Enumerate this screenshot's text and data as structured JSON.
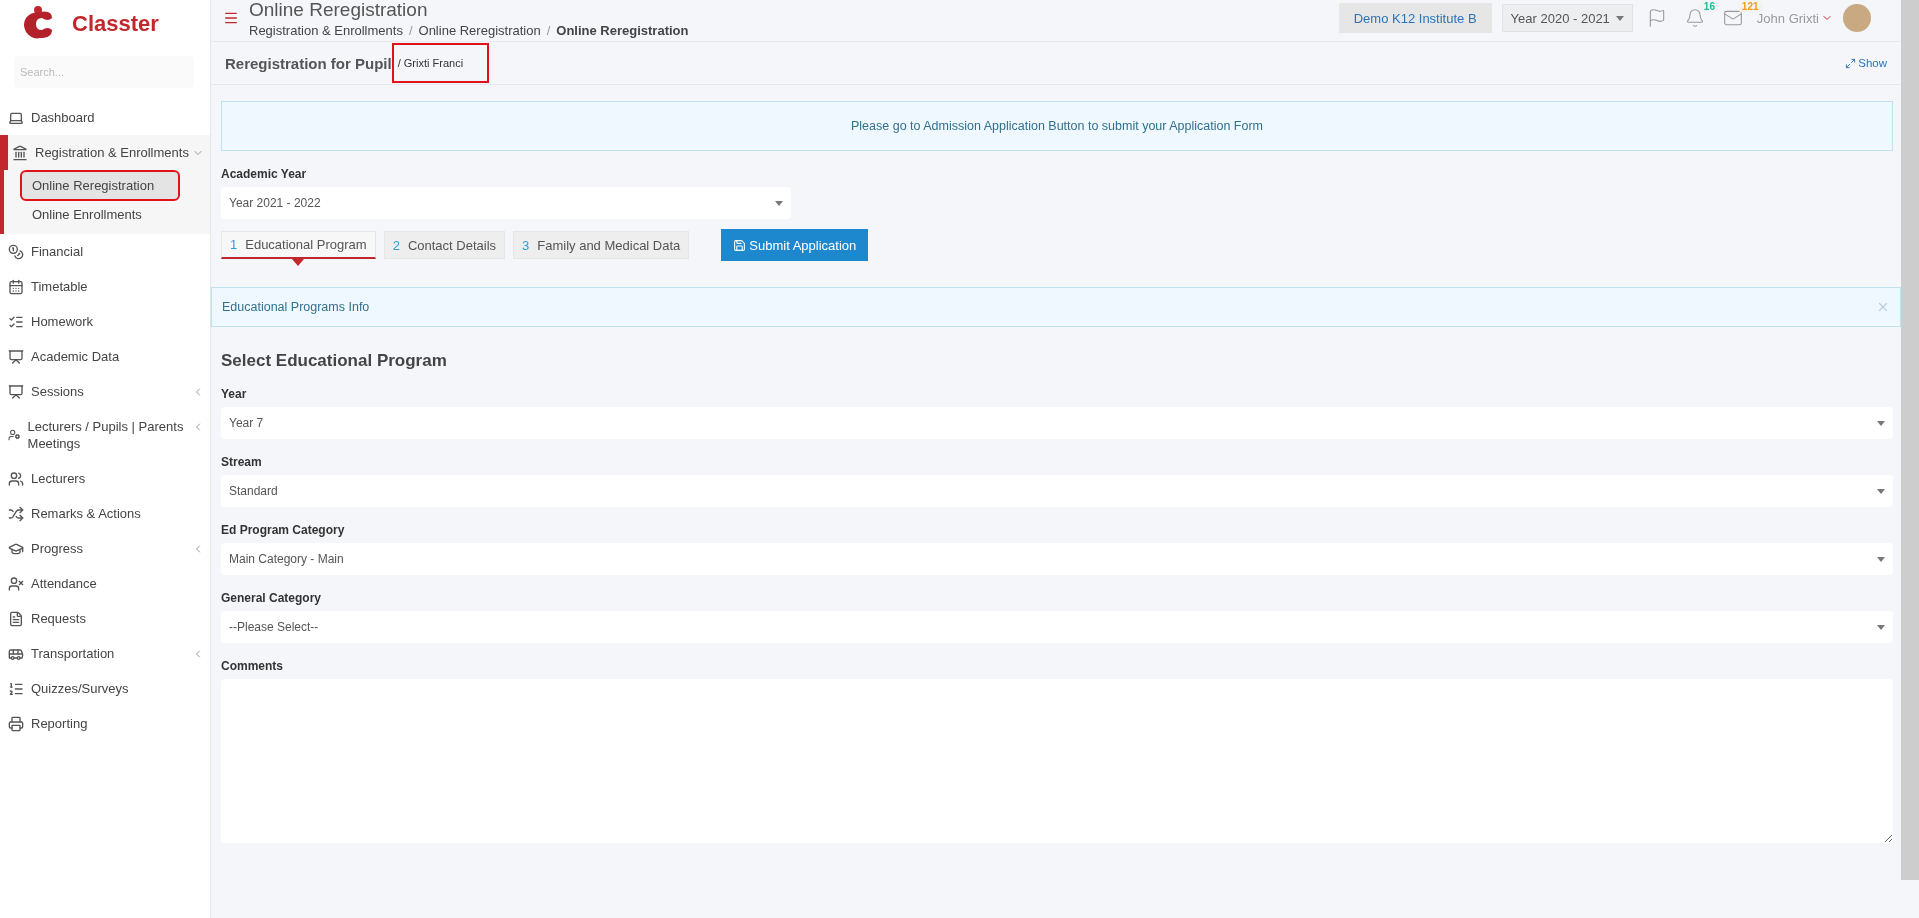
{
  "brand": {
    "name": "Classter"
  },
  "sidebar": {
    "search": {
      "placeholder": "Search..."
    },
    "items": [
      {
        "label": "Dashboard",
        "selected": false
      },
      {
        "label": "Registration & Enrollments",
        "submenu": true,
        "expanded": true,
        "selected": true,
        "children": [
          {
            "label": "Online Reregistration",
            "selected": true,
            "highlighted": true
          },
          {
            "label": "Online Enrollments",
            "selected": false,
            "highlighted": false
          }
        ]
      },
      {
        "label": "Financial",
        "selected": false
      },
      {
        "label": "Timetable",
        "selected": false
      },
      {
        "label": "Homework",
        "selected": false
      },
      {
        "label": "Academic Data",
        "selected": false
      },
      {
        "label": "Sessions",
        "submenu": true,
        "expanded": false,
        "selected": false
      },
      {
        "label": "Lecturers / Pupils | Parents Meetings",
        "submenu": true,
        "expanded": false,
        "selected": false
      },
      {
        "label": "Lecturers",
        "selected": false
      },
      {
        "label": "Remarks & Actions",
        "selected": false
      },
      {
        "label": "Progress",
        "submenu": true,
        "expanded": false,
        "selected": false
      },
      {
        "label": "Attendance",
        "selected": false
      },
      {
        "label": "Requests",
        "selected": false
      },
      {
        "label": "Transportation",
        "submenu": true,
        "expanded": false,
        "selected": false
      },
      {
        "label": "Quizzes/Surveys",
        "selected": false
      },
      {
        "label": "Reporting",
        "selected": false
      }
    ]
  },
  "header": {
    "title": "Online Reregistration",
    "breadcrumbs": [
      "Registration & Enrollments",
      "Online Reregistration",
      "Online Reregistration"
    ],
    "breadcrumb_separator": "/",
    "institute": "Demo K12 Institute B",
    "year": "Year 2020 - 2021",
    "badges": [
      {
        "count": "16",
        "color": "#1abc9c"
      },
      {
        "count": "121",
        "color": "#f39c12"
      }
    ],
    "user": "John Grixti"
  },
  "pupil_bar": {
    "title": "Reregistration for Pupil",
    "pupil": "/ Grixti Franci",
    "pupil_highlighted": true,
    "show_link": "Show"
  },
  "notice": "Please go to Admission Application Button to submit your Application Form",
  "academic_year": {
    "label": "Academic Year",
    "value": "Year 2021 - 2022"
  },
  "tabs": [
    {
      "number": "1",
      "label": "Educational Program",
      "selected": true
    },
    {
      "number": "2",
      "label": "Contact Details",
      "selected": false
    },
    {
      "number": "3",
      "label": "Family and Medical Data",
      "selected": false
    }
  ],
  "submit_button": "Submit Application",
  "info_box": "Educational Programs Info",
  "section_title": "Select Educational Program",
  "fields": [
    {
      "kind": "select",
      "label": "Year",
      "value": "Year 7"
    },
    {
      "kind": "select",
      "label": "Stream",
      "value": "Standard"
    },
    {
      "kind": "select",
      "label": "Ed Program Category",
      "value": "Main Category - Main"
    },
    {
      "kind": "select",
      "label": "General Category",
      "value": "--Please Select--"
    },
    {
      "kind": "textarea",
      "label": "Comments"
    }
  ]
}
